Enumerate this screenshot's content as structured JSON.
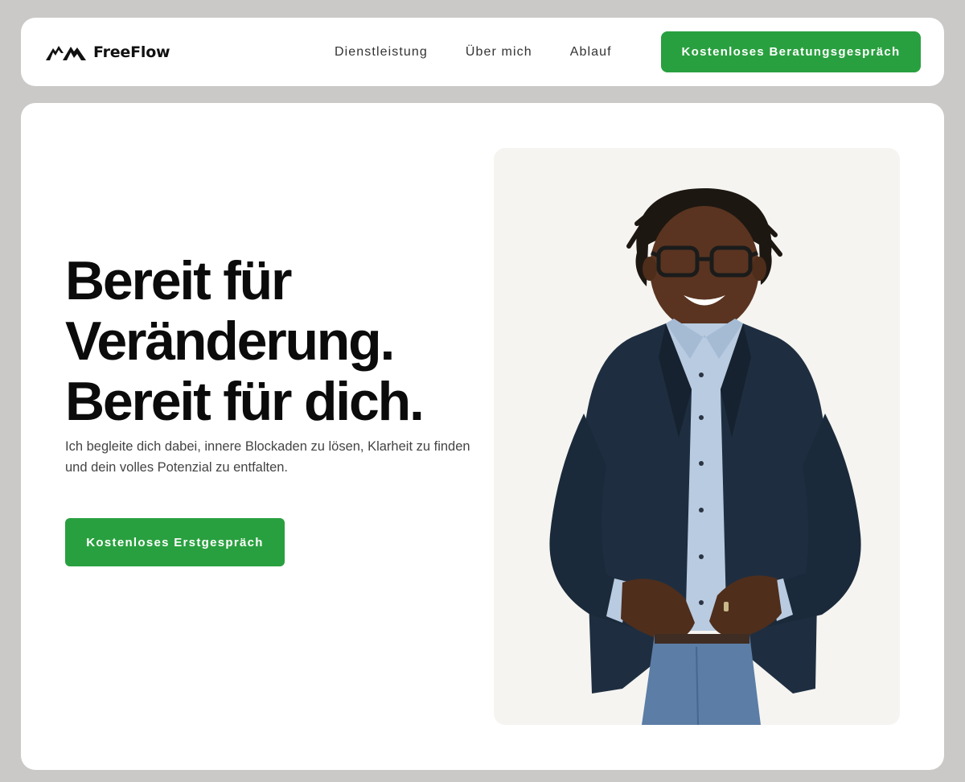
{
  "brand": {
    "name": "FreeFlow",
    "logo_icon": "mountains-icon"
  },
  "nav": {
    "links": [
      "Dienstleistung",
      "Über mich",
      "Ablauf"
    ],
    "cta_label": "Kostenloses Beratungsgespräch"
  },
  "hero": {
    "headline": [
      "Bereit für",
      "Veränderung.",
      "Bereit für dich."
    ],
    "subtext": "Ich begleite dich dabei, innere Blockaden zu lösen, Klarheit zu finden und dein volles Potenzial zu entfalten.",
    "cta_label": "Kostenloses Erstgespräch"
  },
  "colors": {
    "accent": "#29a03f",
    "page_background": "#cbc9c7",
    "card_background": "#ffffff",
    "photo_background": "#f5f4f1"
  }
}
